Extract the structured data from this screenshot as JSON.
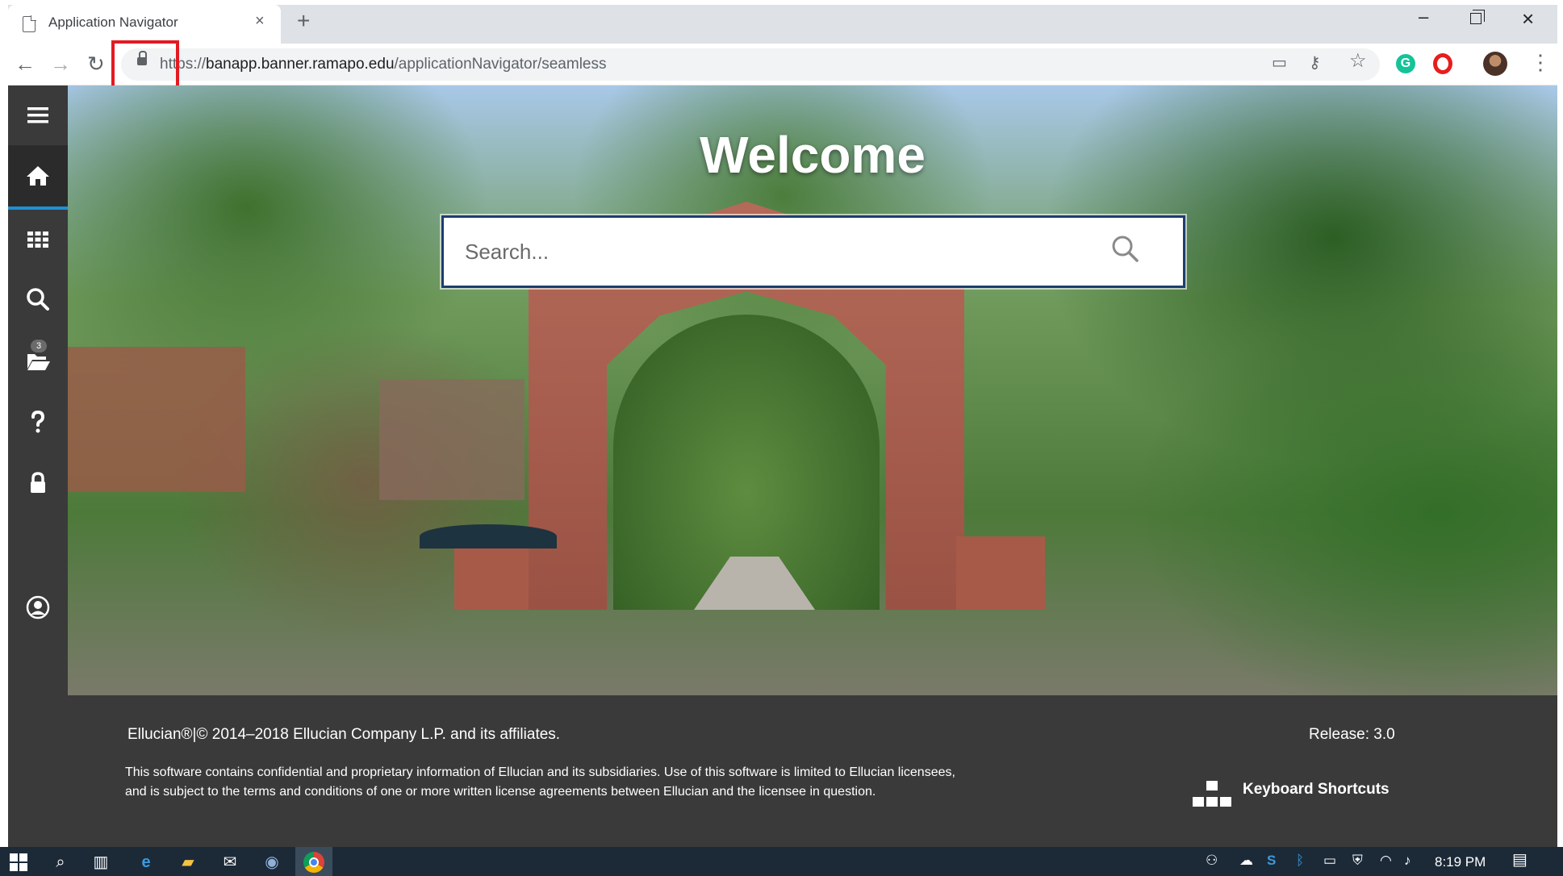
{
  "browser": {
    "tab_title": "Application Navigator",
    "tab_close": "×",
    "new_tab": "+",
    "url_prefix": "https://",
    "url_host": "banapp.banner.ramapo.edu",
    "url_path": "/applicationNavigator/seamless",
    "window_minimize": "–",
    "window_close": "×",
    "menu": "⋮",
    "extensions": {
      "grammarly": "G"
    }
  },
  "hero": {
    "title": "Welcome",
    "search_placeholder": "Search..."
  },
  "sidebar": {
    "items": [
      {
        "name": "menu"
      },
      {
        "name": "home"
      },
      {
        "name": "applications"
      },
      {
        "name": "search"
      },
      {
        "name": "recently-opened",
        "badge": "3"
      },
      {
        "name": "help"
      },
      {
        "name": "sign-out"
      },
      {
        "name": "user-profile"
      }
    ]
  },
  "footer": {
    "copyright": "Ellucian®|© 2014–2018 Ellucian Company L.P. and its affiliates.",
    "release": "Release: 3.0",
    "legal": "This software contains confidential and proprietary information of Ellucian and its subsidiaries. Use of this software is limited to Ellucian licensees, and is subject to the terms and conditions of one or more written license agreements between Ellucian and the licensee in question.",
    "keyboard_shortcuts": "Keyboard Shortcuts"
  },
  "taskbar": {
    "clock": "8:19 PM"
  },
  "colors": {
    "sidebar_bg": "#3a3a3a",
    "active_indicator": "#1e90d6",
    "search_border": "#1d3e6e",
    "highlight_box": "#e21a22"
  }
}
